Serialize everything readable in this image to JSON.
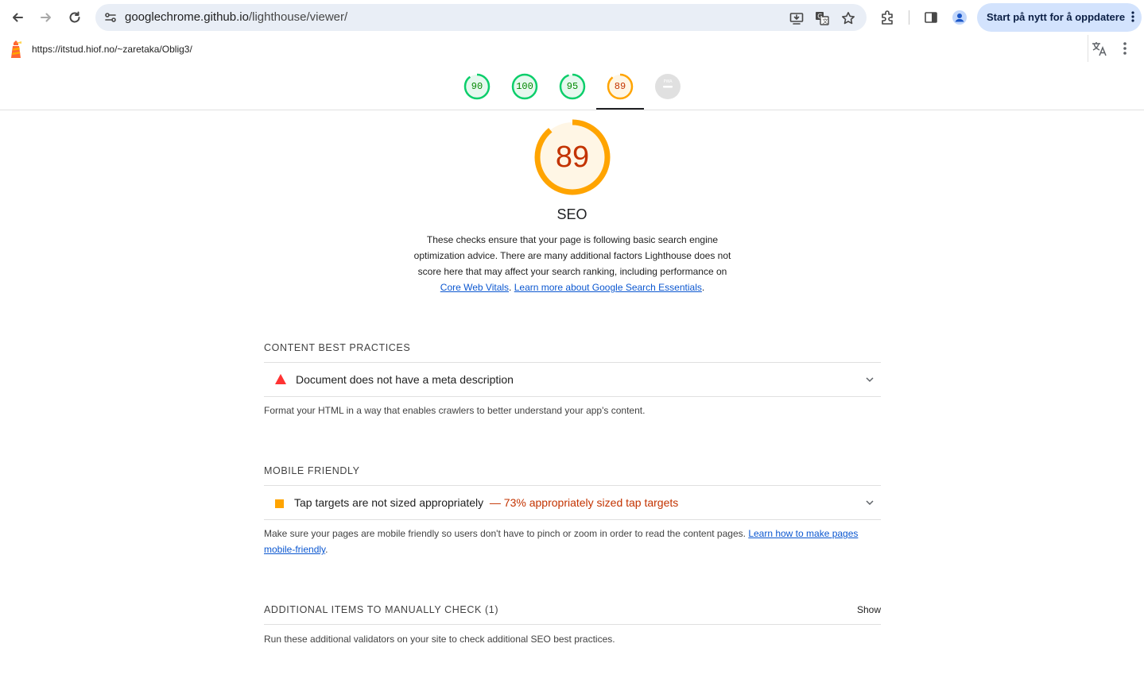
{
  "browser": {
    "url_host": "googlechrome.github.io",
    "url_path": "/lighthouse/viewer/",
    "update_button_label": "Start på nytt for å oppdatere"
  },
  "report": {
    "tested_url": "https://itstud.hiof.no/~zaretaka/Oblig3/"
  },
  "score_tabs": [
    {
      "label": "90",
      "score": 90,
      "color": "#0cce6b",
      "fill": "#e6f8ee",
      "text_color": "#008800"
    },
    {
      "label": "100",
      "score": 100,
      "color": "#0cce6b",
      "fill": "#e6f8ee",
      "text_color": "#008800"
    },
    {
      "label": "95",
      "score": 95,
      "color": "#0cce6b",
      "fill": "#e6f8ee",
      "text_color": "#008800"
    },
    {
      "label": "89",
      "score": 89,
      "color": "#ffa400",
      "fill": "#fff6e5",
      "text_color": "#c33300"
    },
    {
      "label": "PWA",
      "score": null,
      "color": "#e0e0e0",
      "fill": "#e0e0e0",
      "text_color": "#ffffff"
    }
  ],
  "category": {
    "score_label": "89",
    "score": 89,
    "title": "SEO",
    "description": "These checks ensure that your page is following basic search engine optimization advice. There are many additional factors Lighthouse does not score here that may affect your search ranking, including performance on",
    "link_core_web_vitals": "Core Web Vitals",
    "link_separator": ".",
    "link_search_essentials": "Learn more about Google Search Essentials",
    "end_period": "."
  },
  "groups": {
    "content": {
      "title": "CONTENT BEST PRACTICES",
      "audit_title": "Document does not have a meta description",
      "description": "Format your HTML in a way that enables crawlers to better understand your app's content."
    },
    "mobile": {
      "title": "MOBILE FRIENDLY",
      "audit_title": "Tap targets are not sized appropriately",
      "audit_display": "— 73% appropriately sized tap targets",
      "description": "Make sure your pages are mobile friendly so users don't have to pinch or zoom in order to read the content pages.",
      "link": "Learn how to make pages mobile-friendly",
      "end_period": "."
    },
    "manual": {
      "title": "ADDITIONAL ITEMS TO MANUALLY CHECK",
      "count": "(1)",
      "toggle": "Show",
      "description": "Run these additional validators on your site to check additional SEO best practices."
    }
  },
  "colors": {
    "fail": "#ff3333",
    "average": "#ffa400",
    "pass": "#0cce6b",
    "link": "#0b57d0"
  }
}
